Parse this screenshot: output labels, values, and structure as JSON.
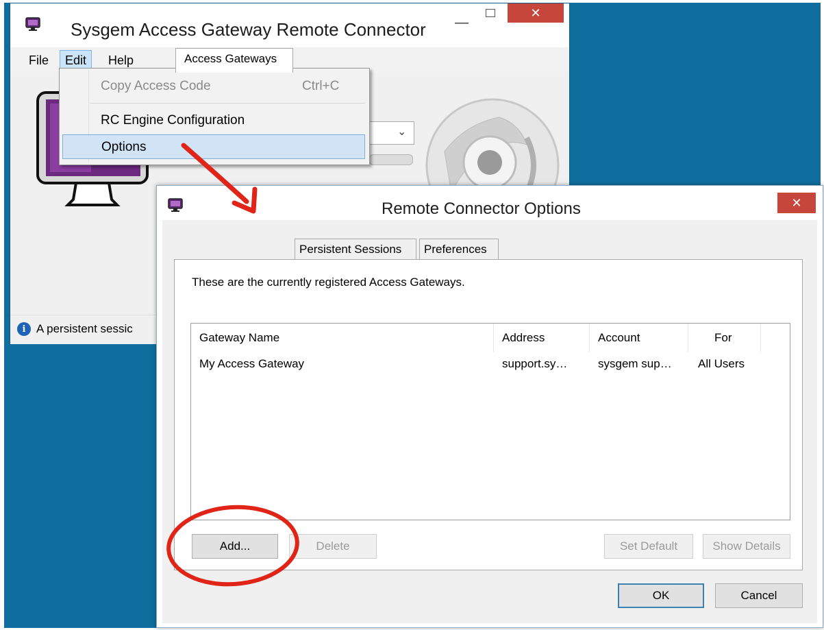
{
  "main_window": {
    "title": "Sysgem Access Gateway Remote Connector",
    "menu": [
      "File",
      "Edit",
      "Help"
    ],
    "status_text": "A persistent sessic"
  },
  "edit_menu": {
    "items": [
      {
        "label": "Copy Access Code",
        "shortcut": "Ctrl+C",
        "enabled": false
      },
      {
        "label": "RC Engine Configuration",
        "enabled": true
      },
      {
        "label": "Options",
        "enabled": true,
        "highlighted": true
      }
    ]
  },
  "dialog": {
    "title": "Remote Connector Options",
    "tabs": [
      "Access Gateways",
      "Persistent Sessions",
      "Preferences"
    ],
    "active_tab": "Access Gateways",
    "description": "These are the currently registered Access Gateways.",
    "table": {
      "columns": [
        "Gateway Name",
        "Address",
        "Account",
        "For"
      ],
      "rows": [
        [
          "My Access Gateway",
          "support.sy…",
          "sysgem sup…",
          "All Users"
        ]
      ]
    },
    "buttons": {
      "add": "Add...",
      "delete": "Delete",
      "set_default": "Set Default",
      "show_details": "Show Details",
      "ok": "OK",
      "cancel": "Cancel"
    }
  },
  "colors": {
    "desktop": "#0f6e9d",
    "close_button": "#c7463c",
    "annotation": "#e02418"
  }
}
